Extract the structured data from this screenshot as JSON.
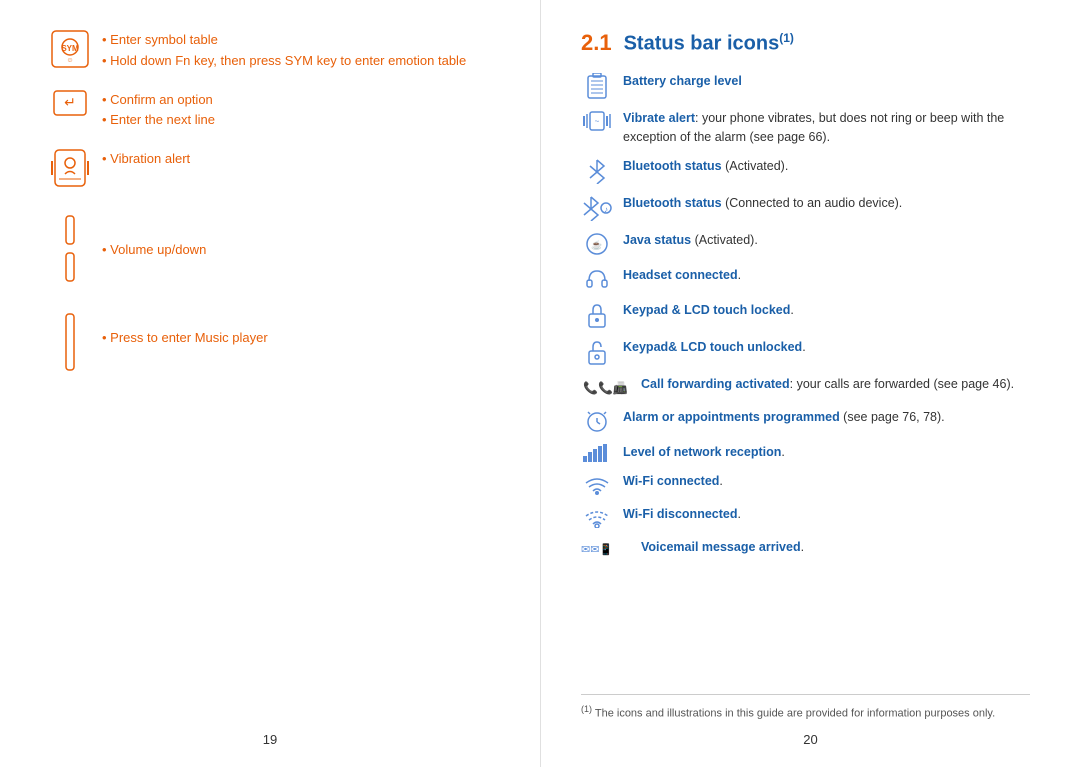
{
  "left": {
    "page_number": "19",
    "items": [
      {
        "id": "sym-key",
        "bullets": [
          "Enter symbol table",
          "Hold down Fn key, then press SYM key to enter emotion table"
        ]
      },
      {
        "id": "enter-key",
        "bullets": [
          "Confirm an option",
          "Enter the next line"
        ]
      },
      {
        "id": "vibration",
        "bullets": [
          "Vibration alert"
        ]
      },
      {
        "id": "volume",
        "bullets": [
          "Volume up/down"
        ]
      },
      {
        "id": "music",
        "bullets": [
          "Press to enter Music player"
        ]
      }
    ]
  },
  "right": {
    "page_number": "20",
    "section": {
      "number": "2.1",
      "title": "Status bar icons",
      "superscript": "(1)"
    },
    "items": [
      {
        "icon": "battery",
        "text_bold": "Battery charge level",
        "text_normal": ""
      },
      {
        "icon": "vibrate",
        "text_bold": "Vibrate alert",
        "text_normal": ": your phone vibrates, but does not ring or beep with the exception of the alarm (see page 66)."
      },
      {
        "icon": "bluetooth-active",
        "text_bold": "Bluetooth status",
        "text_normal": " (Activated)."
      },
      {
        "icon": "bluetooth-audio",
        "text_bold": "Bluetooth status",
        "text_normal": " (Connected to an audio device)."
      },
      {
        "icon": "java",
        "text_bold": "Java status",
        "text_normal": " (Activated)."
      },
      {
        "icon": "headset",
        "text_bold": "Headset connected",
        "text_normal": "."
      },
      {
        "icon": "keypad-locked",
        "text_bold": "Keypad & LCD touch locked",
        "text_normal": "."
      },
      {
        "icon": "keypad-unlocked",
        "text_bold": "Keypad& LCD touch unlocked",
        "text_normal": "."
      },
      {
        "icon": "call-forward",
        "text_bold": "Call forwarding activated",
        "text_normal": ": your calls are forwarded (see page 46)."
      },
      {
        "icon": "alarm",
        "text_bold": "Alarm or appointments programmed",
        "text_normal": " (see page 76, 78)."
      },
      {
        "icon": "signal",
        "text_bold": "Level of network reception",
        "text_normal": "."
      },
      {
        "icon": "wifi-on",
        "text_bold": "Wi-Fi connected",
        "text_normal": "."
      },
      {
        "icon": "wifi-off",
        "text_bold": "Wi-Fi disconnected",
        "text_normal": "."
      },
      {
        "icon": "voicemail",
        "text_bold": "Voicemail message arrived",
        "text_normal": "."
      }
    ],
    "footnote": {
      "marker": "(1)",
      "text": "The icons and illustrations in this guide are provided for information purposes only."
    }
  }
}
